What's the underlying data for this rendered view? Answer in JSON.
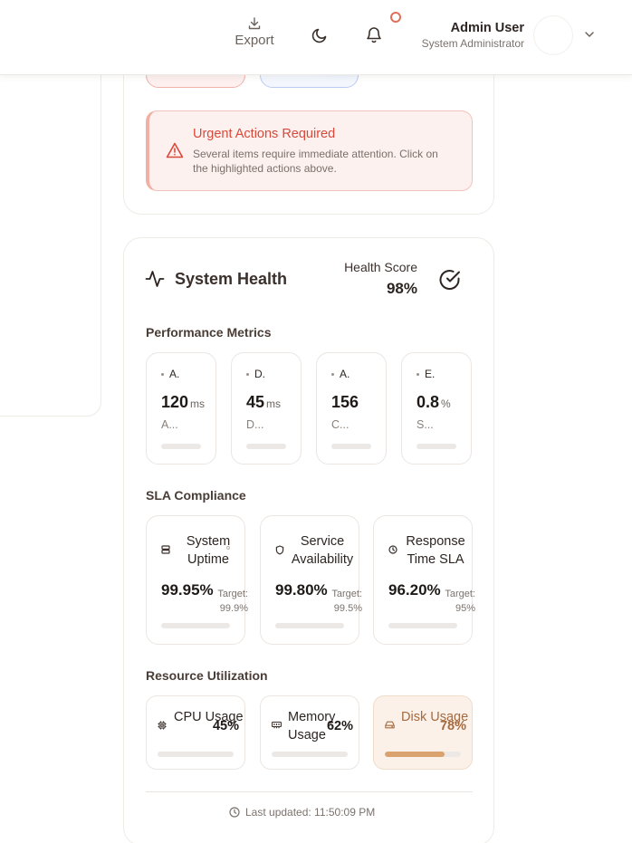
{
  "header": {
    "export_label": "Export",
    "user_name": "Admin User",
    "user_role": "System Administrator",
    "icons": [
      "download-icon",
      "moon-icon",
      "bell-icon",
      "chevron-down-icon"
    ]
  },
  "alert": {
    "title": "Urgent Actions Required",
    "text": "Several items require immediate attention. Click on the highlighted actions above.",
    "icon": "warning-triangle-icon"
  },
  "system_health": {
    "title": "System Health",
    "score_label": "Health Score",
    "score_value": "98%",
    "performance": {
      "title": "Performance Metrics",
      "metrics": [
        {
          "abbr": "A.",
          "value": "120",
          "unit": "ms",
          "name": "A..."
        },
        {
          "abbr": "D.",
          "value": "45",
          "unit": "ms",
          "name": "D..."
        },
        {
          "abbr": "A.",
          "value": "156",
          "unit": "",
          "name": "C..."
        },
        {
          "abbr": "E.",
          "value": "0.8",
          "unit": "%",
          "name": "S..."
        }
      ]
    },
    "sla": {
      "title": "SLA Compliance",
      "items": [
        {
          "name": "System Uptime",
          "value": "99.95%",
          "target": "Target: 99.9%",
          "icon": "server-icon"
        },
        {
          "name": "Service Availability",
          "value": "99.80%",
          "target": "Target: 99.5%",
          "icon": "shield-icon"
        },
        {
          "name": "Response Time SLA",
          "value": "96.20%",
          "target": "Target: 95%",
          "icon": "clock-icon"
        }
      ]
    },
    "resources": {
      "title": "Resource Utilization",
      "items": [
        {
          "name": "CPU Usage",
          "value": "45%",
          "level": 0.45,
          "icon": "cpu-icon"
        },
        {
          "name": "Memory Usage",
          "value": "62%",
          "level": 0.62,
          "icon": "memory-icon"
        },
        {
          "name": "Disk Usage",
          "value": "78%",
          "level": 0.78,
          "icon": "disk-icon",
          "status": "warning"
        }
      ]
    },
    "last_updated": "Last updated: 11:50:09 PM"
  },
  "colors": {
    "alert_red": "#d9493a",
    "warning_amber": "#d9a26e",
    "accent_dark": "#2d2521"
  }
}
